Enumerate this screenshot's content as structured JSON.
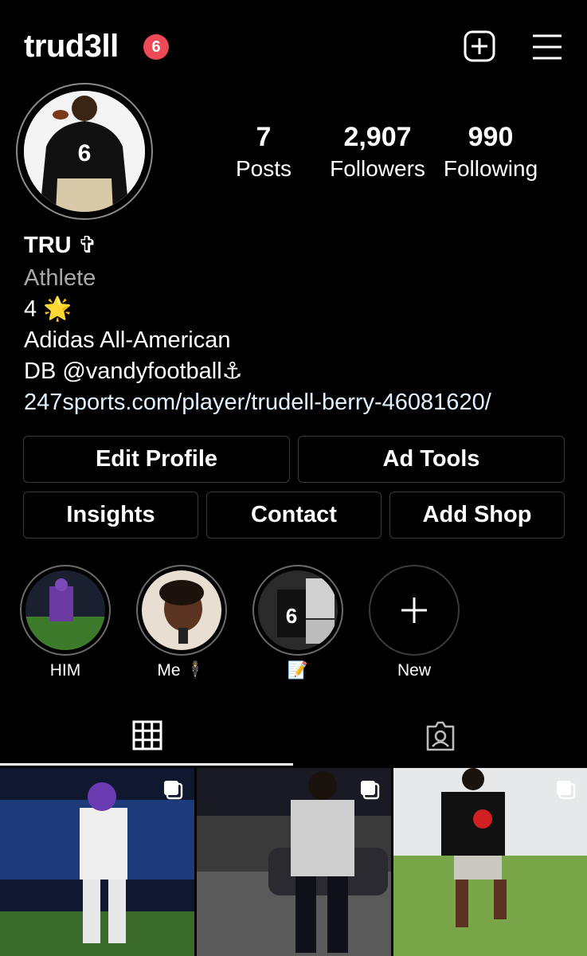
{
  "header": {
    "username": "trud3ll",
    "notification_count": "6"
  },
  "stats": [
    {
      "value": "7",
      "label": "Posts"
    },
    {
      "value": "2,907",
      "label": "Followers"
    },
    {
      "value": "990",
      "label": "Following"
    }
  ],
  "bio": {
    "name": "TRU ✞",
    "category": "Athlete",
    "line1": "4 🌟",
    "line2": "Adidas All-American",
    "line3": "DB @vandyfootball⚓",
    "link": "247sports.com/player/trudell-berry-46081620/"
  },
  "buttons": {
    "edit_profile": "Edit Profile",
    "ad_tools": "Ad Tools",
    "insights": "Insights",
    "contact": "Contact",
    "add_shop": "Add Shop"
  },
  "highlights": [
    {
      "label": "HIM"
    },
    {
      "label": "Me 🕴"
    },
    {
      "label": "📝"
    },
    {
      "label": "New"
    }
  ],
  "tabs": [
    "grid-icon",
    "tagged-icon"
  ],
  "colors": {
    "background": "#000000",
    "badge": "#ed4956",
    "link": "#e0f1ff",
    "secondary_text": "#a8a8a8"
  }
}
